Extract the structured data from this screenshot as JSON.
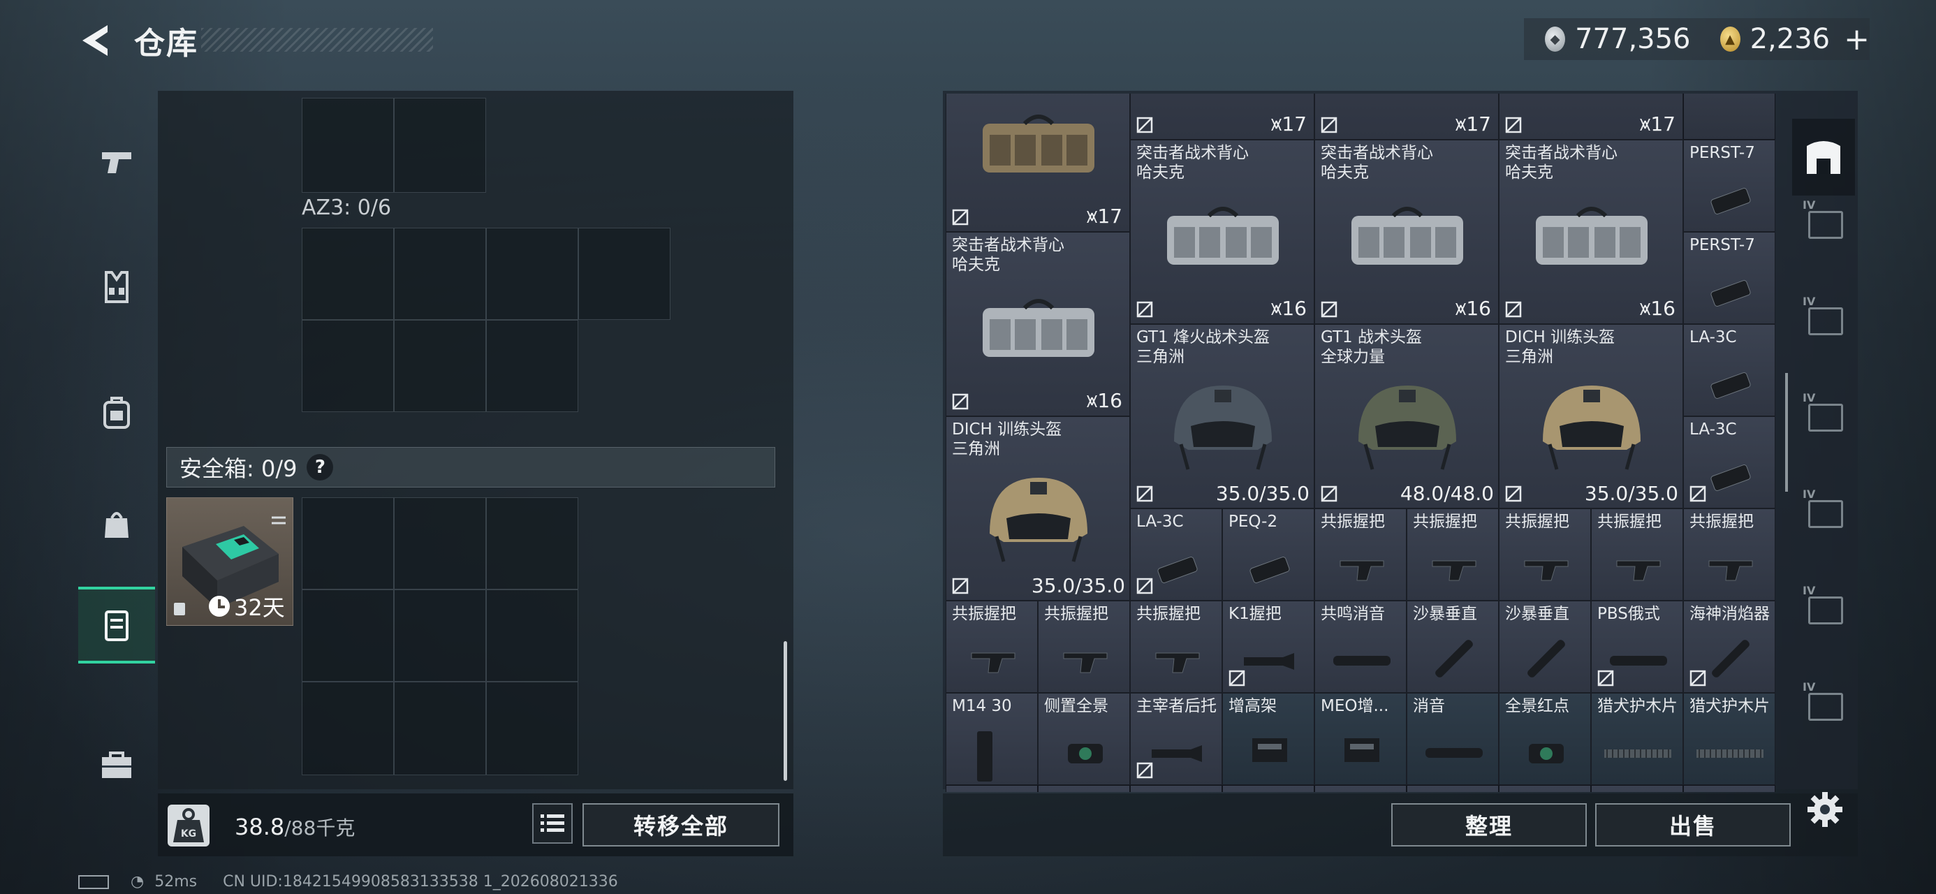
{
  "header": {
    "title": "仓库",
    "silver_amount": "777,356",
    "gold_amount": "2,236",
    "gold_plus": "+"
  },
  "left_nav": [
    {
      "name": "weapon"
    },
    {
      "name": "vest"
    },
    {
      "name": "backpack"
    },
    {
      "name": "pouch"
    },
    {
      "name": "safebox"
    },
    {
      "name": "toolbox"
    }
  ],
  "container": {
    "az3_label": "AZ3: 0/6",
    "safebox_label": "安全箱: 0/9",
    "safebox_help": "?",
    "safebox_timer": "32天"
  },
  "footer": {
    "weight_current": "38.8",
    "weight_capacity": "/88千克",
    "transfer_all": "转移全部",
    "sort": "整理",
    "sell": "出售"
  },
  "inventory": {
    "items": [
      {
        "name": "",
        "count": "17"
      },
      {
        "name": "",
        "count": "17"
      },
      {
        "name": "",
        "count": "17"
      },
      {
        "name": "",
        "count": "17"
      },
      {
        "name": "突击者战术背心\n哈夫克",
        "count": "16"
      },
      {
        "name": "突击者战术背心\n哈夫克",
        "count": "16"
      },
      {
        "name": "突击者战术背心\n哈夫克",
        "count": "16"
      },
      {
        "name": "突击者战术背心\n哈夫克",
        "count": "16"
      },
      {
        "name": "PERST-7"
      },
      {
        "name": "PERST-7"
      },
      {
        "name": "GT1 烽火战术头盔\n三角洲",
        "durability": "35.0/35.0"
      },
      {
        "name": "GT1 战术头盔\n全球力量",
        "durability": "48.0/48.0"
      },
      {
        "name": "DICH 训练头盔\n三角洲",
        "durability": "35.0/35.0"
      },
      {
        "name": "DICH 训练头盔\n三角洲",
        "durability": "35.0/35.0"
      },
      {
        "name": "LA-3C"
      },
      {
        "name": "LA-3C"
      },
      {
        "name": "LA-3C"
      },
      {
        "name": "PEQ-2"
      },
      {
        "name": "共振握把"
      },
      {
        "name": "共振握把"
      },
      {
        "name": "共振握把"
      },
      {
        "name": "共振握把"
      },
      {
        "name": "共振握把"
      },
      {
        "name": "共振握把"
      },
      {
        "name": "共振握把"
      },
      {
        "name": "共振握把"
      },
      {
        "name": "K1握把"
      },
      {
        "name": "共鸣消音"
      },
      {
        "name": "沙暴垂直"
      },
      {
        "name": "沙暴垂直"
      },
      {
        "name": "PBS俄式"
      },
      {
        "name": "海神消焰器"
      },
      {
        "name": "M14 30"
      },
      {
        "name": "侧置全景"
      },
      {
        "name": "主宰者后托"
      },
      {
        "name": "增高架"
      },
      {
        "name": "MEO增..."
      },
      {
        "name": "消音"
      },
      {
        "name": "全景红点"
      },
      {
        "name": "猎犬护木片"
      },
      {
        "name": "猎犬护木片"
      }
    ]
  },
  "right_filters": [
    {
      "name": "all",
      "label": ""
    },
    {
      "name": "cat1",
      "label": "IV"
    },
    {
      "name": "cat2",
      "label": "IV"
    },
    {
      "name": "cat3",
      "label": "IV"
    },
    {
      "name": "cat4",
      "label": "IV"
    },
    {
      "name": "cat5",
      "label": "IV"
    },
    {
      "name": "cat6",
      "label": "IV"
    }
  ],
  "status_bar": {
    "ping": "52ms",
    "uid": "CN UID:18421549908583133538 1_202608021336"
  },
  "colors": {
    "accent": "#32d2a0",
    "panel": "#1e242d",
    "slot": "#343b49"
  }
}
